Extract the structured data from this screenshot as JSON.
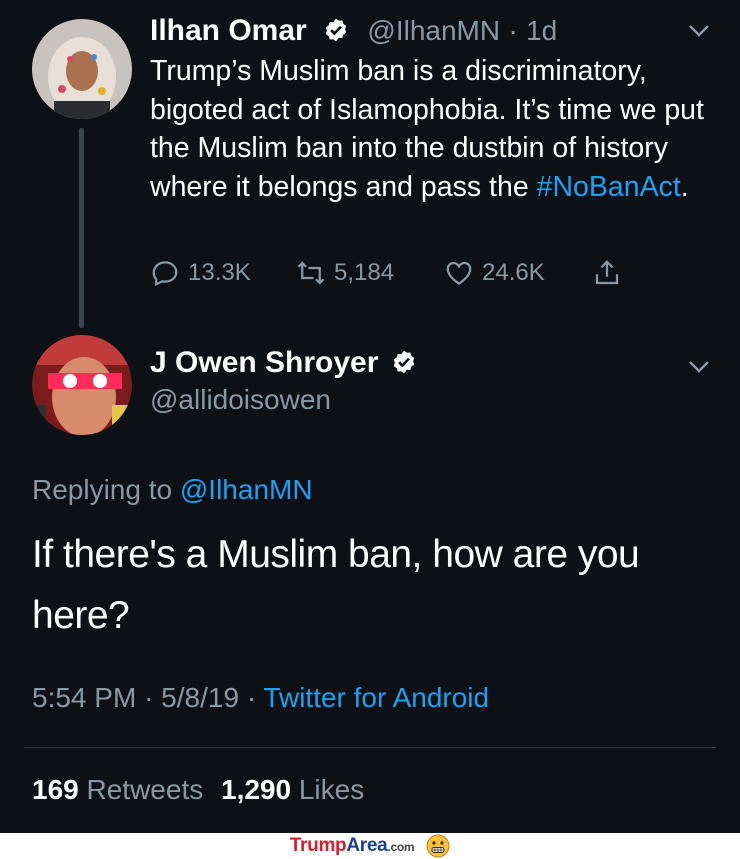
{
  "tweet": {
    "author_name": "Ilhan Omar",
    "handle": "@IlhanMN",
    "separator": "·",
    "time_ago": "1d",
    "text_main": "Trump’s Muslim ban is a discriminatory, bigoted act of Islamophobia. It’s time we put the Muslim ban into the dustbin of history where it belongs and pass the",
    "hashtag": "#NoBanAct",
    "text_end": ".",
    "replies": "13.3K",
    "retweets": "5,184",
    "likes": "24.6K"
  },
  "reply": {
    "author_name": "J Owen Shroyer",
    "handle": "@allidoisowen",
    "replying_prefix": "Replying to",
    "replying_handle": "@IlhanMN",
    "text": "If there's a Muslim ban, how are you here?",
    "time": "5:54 PM",
    "sep1": "·",
    "date": "5/8/19",
    "sep2": "·",
    "source": "Twitter for Android",
    "retweet_count": "169",
    "retweet_label": "Retweets",
    "like_count": "1,290",
    "like_label": "Likes"
  },
  "footer": {
    "brand_a": "Trump",
    "brand_b": "Area",
    "brand_c": ".com"
  },
  "colors": {
    "background": "#0d1015",
    "accent": "#1da1f2",
    "muted": "#8899a6",
    "brand_red": "#d81e2a",
    "brand_blue": "#1d3f8f"
  },
  "icons": [
    "verified-badge-icon",
    "chevron-down-icon",
    "reply-icon",
    "retweet-icon",
    "like-icon",
    "share-icon",
    "grimace-emoji-icon"
  ]
}
